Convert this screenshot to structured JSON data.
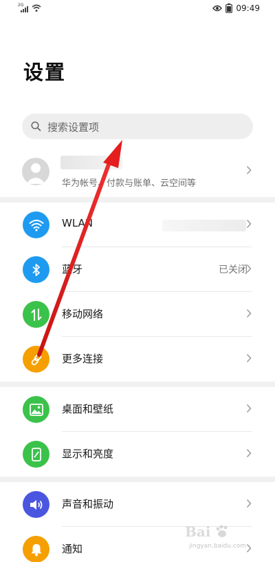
{
  "status_bar": {
    "network": "2G",
    "time": "09:49"
  },
  "page": {
    "title": "设置"
  },
  "search": {
    "placeholder": "搜索设置项"
  },
  "account": {
    "subtitle": "华为帐号、付款与账单、云空间等"
  },
  "rows": [
    {
      "label": "WLAN",
      "value": "",
      "icon": "wifi-icon",
      "color": "#1e9bf0"
    },
    {
      "label": "蓝牙",
      "value": "已关闭",
      "icon": "bluetooth-icon",
      "color": "#1e9bf0"
    },
    {
      "label": "移动网络",
      "value": "",
      "icon": "mobile-data-icon",
      "color": "#3bc24a"
    },
    {
      "label": "更多连接",
      "value": "",
      "icon": "link-icon",
      "color": "#f5a000"
    },
    {
      "label": "桌面和壁纸",
      "value": "",
      "icon": "wallpaper-icon",
      "color": "#3bc24a"
    },
    {
      "label": "显示和亮度",
      "value": "",
      "icon": "display-icon",
      "color": "#3bc24a"
    },
    {
      "label": "声音和振动",
      "value": "",
      "icon": "sound-icon",
      "color": "#4b56e0"
    },
    {
      "label": "通知",
      "value": "",
      "icon": "notification-icon",
      "color": "#f5a000"
    }
  ],
  "watermark": {
    "brand": "Bai",
    "url": "jingyan.baidu.com"
  },
  "colors": {
    "annotation_arrow": "#e41e1e",
    "section_gap": "#f1f1f1"
  }
}
